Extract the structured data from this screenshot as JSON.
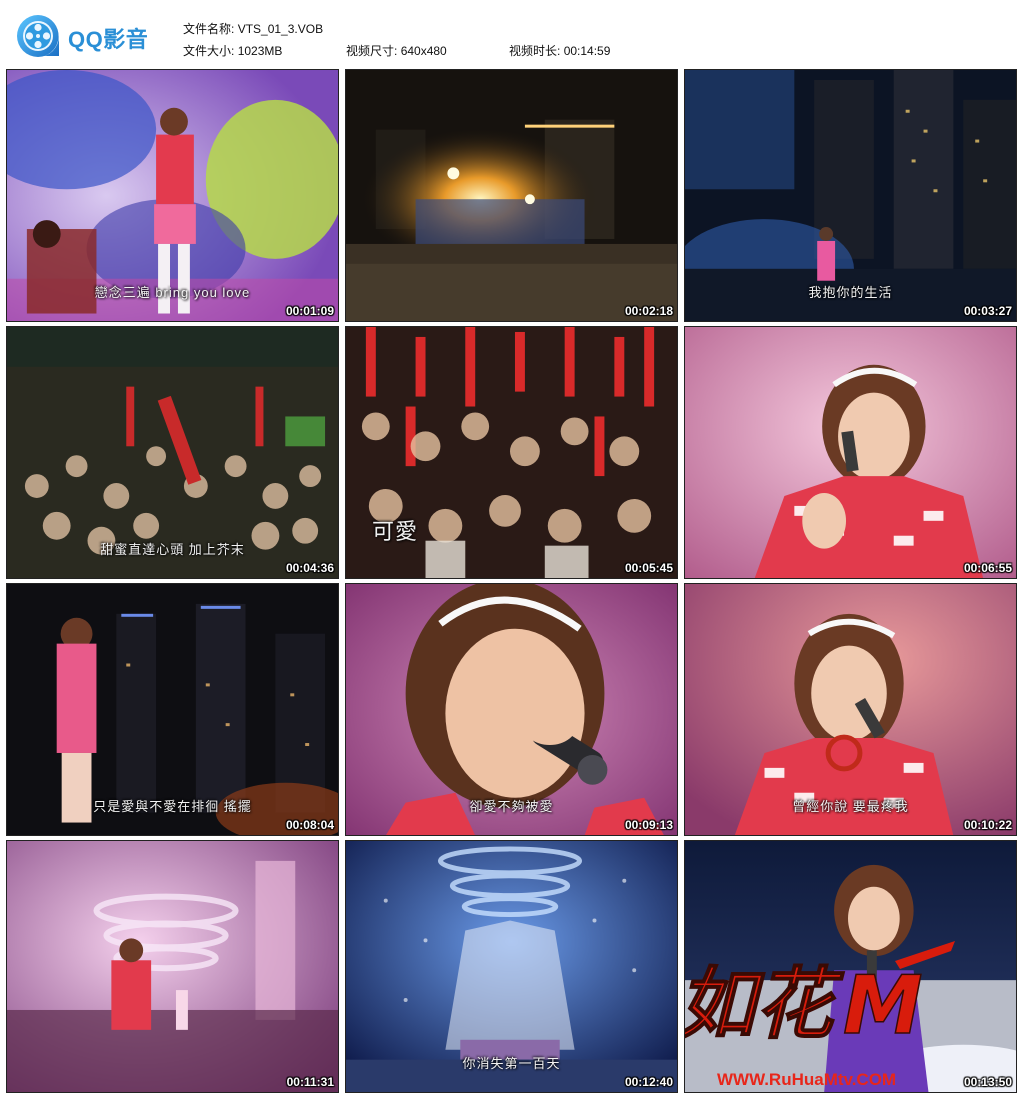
{
  "app": {
    "logo_text": "QQ影音",
    "logo_icon": "film-reel-icon"
  },
  "file_info": {
    "name_label": "文件名称:",
    "name_value": "VTS_01_3.VOB",
    "size_label": "文件大小:",
    "size_value": "1023MB",
    "dim_label": "视频尺寸:",
    "dim_value": "640x480",
    "dur_label": "视频时长:",
    "dur_value": "00:14:59"
  },
  "thumbnails": [
    {
      "time": "00:01:09",
      "subtitle": "戀念三遍 bring you love"
    },
    {
      "time": "00:02:18",
      "subtitle": ""
    },
    {
      "time": "00:03:27",
      "subtitle": "我抱你的生活"
    },
    {
      "time": "00:04:36",
      "subtitle": "甜蜜直達心頭  加上芥末"
    },
    {
      "time": "00:05:45",
      "subtitle": "可愛"
    },
    {
      "time": "00:06:55",
      "subtitle": ""
    },
    {
      "time": "00:08:04",
      "subtitle": "只是愛與不愛在排徊 搖擺"
    },
    {
      "time": "00:09:13",
      "subtitle": "卻愛不夠被愛"
    },
    {
      "time": "00:10:22",
      "subtitle": "曾經你說 要最疼我"
    },
    {
      "time": "00:11:31",
      "subtitle": ""
    },
    {
      "time": "00:12:40",
      "subtitle": "你消失第一百天"
    },
    {
      "time": "00:13:50",
      "subtitle": ""
    }
  ],
  "watermark": {
    "logo_text": "如花",
    "url": "WWW.RuHuaMtv.COM"
  },
  "colors": {
    "brand": "#2a8fd6",
    "watermark_red": "#d81c0c"
  }
}
